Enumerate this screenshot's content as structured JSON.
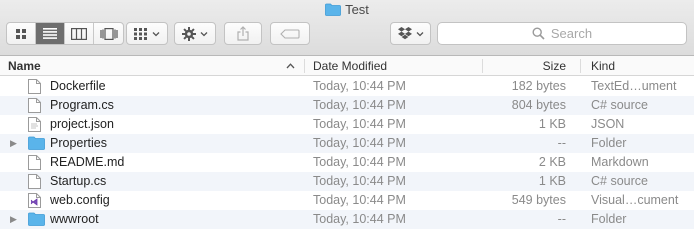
{
  "window": {
    "title": "Test"
  },
  "toolbar": {
    "search_placeholder": "Search"
  },
  "columns": {
    "name": "Name",
    "date": "Date Modified",
    "size": "Size",
    "kind": "Kind"
  },
  "files": [
    {
      "name": "Dockerfile",
      "date": "Today, 10:44 PM",
      "size": "182 bytes",
      "kind": "TextEd…ument",
      "icon": "doc-icon",
      "folder": false
    },
    {
      "name": "Program.cs",
      "date": "Today, 10:44 PM",
      "size": "804 bytes",
      "kind": "C# source",
      "icon": "doc-icon",
      "folder": false
    },
    {
      "name": "project.json",
      "date": "Today, 10:44 PM",
      "size": "1 KB",
      "kind": "JSON",
      "icon": "json-icon",
      "folder": false
    },
    {
      "name": "Properties",
      "date": "Today, 10:44 PM",
      "size": "--",
      "kind": "Folder",
      "icon": "folder-icon",
      "folder": true
    },
    {
      "name": "README.md",
      "date": "Today, 10:44 PM",
      "size": "2 KB",
      "kind": "Markdown",
      "icon": "doc-icon",
      "folder": false
    },
    {
      "name": "Startup.cs",
      "date": "Today, 10:44 PM",
      "size": "1 KB",
      "kind": "C# source",
      "icon": "doc-icon",
      "folder": false
    },
    {
      "name": "web.config",
      "date": "Today, 10:44 PM",
      "size": "549 bytes",
      "kind": "Visual…cument",
      "icon": "visual-studio-icon",
      "folder": false
    },
    {
      "name": "wwwroot",
      "date": "Today, 10:44 PM",
      "size": "--",
      "kind": "Folder",
      "icon": "folder-icon",
      "folder": true
    }
  ],
  "colors": {
    "folder": "#5ab4ea",
    "stripe": "#f2f5fa",
    "muted_text": "#8a8a8a"
  }
}
